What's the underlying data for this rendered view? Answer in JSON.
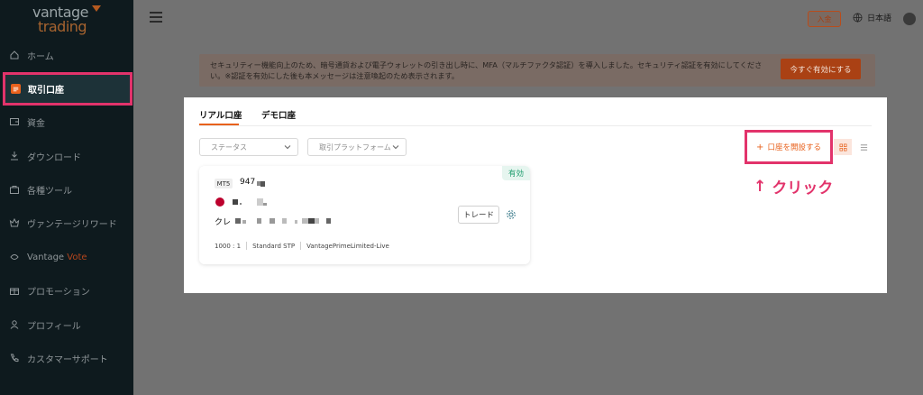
{
  "brand": {
    "line1": "vantage",
    "line2": "trading"
  },
  "sidebar": {
    "items": [
      {
        "label": "ホーム",
        "icon": "home-icon"
      },
      {
        "label": "取引口座",
        "icon": "account-icon",
        "active": true
      },
      {
        "label": "資金",
        "icon": "wallet-icon"
      },
      {
        "label": "ダウンロード",
        "icon": "download-icon"
      },
      {
        "label": "各種ツール",
        "icon": "tools-icon"
      },
      {
        "label": "ヴァンテージリワード",
        "icon": "reward-icon"
      },
      {
        "label": "Vantage",
        "label_accent": "Vote",
        "icon": "vote-icon"
      },
      {
        "label": "プロモーション",
        "icon": "gift-icon"
      },
      {
        "label": "プロフィール",
        "icon": "profile-icon"
      },
      {
        "label": "カスタマーサポート",
        "icon": "phone-icon"
      }
    ]
  },
  "header": {
    "deposit_label": "入金",
    "language": "日本語"
  },
  "notice": {
    "text": "セキュリティー機能向上のため、暗号通貨および電子ウォレットの引き出し時に、MFA（マルチファクタ認証）を導入しました。セキュリティ認証を有効にしてください。※認証を有効にした後も本メッセージは注意喚起のため表示されます。",
    "button_label": "今すぐ有効にする"
  },
  "tabs": [
    {
      "label": "リアル口座",
      "active": true
    },
    {
      "label": "デモ口座",
      "active": false
    }
  ],
  "filters": {
    "status_placeholder": "ステータス",
    "platform_placeholder": "取引プラットフォーム"
  },
  "open_account_label": "口座を開設する",
  "annotation": {
    "arrow": "↑",
    "text": "クリック"
  },
  "account": {
    "status": "有効",
    "platform": "MT5",
    "number_prefix": "947",
    "credit_prefix": "クレ",
    "trade_label": "トレード",
    "leverage": "1000 : 1",
    "type": "Standard STP",
    "server": "VantagePrimeLimited-Live"
  },
  "colors": {
    "accent": "#e8611c",
    "highlight": "#e2336b",
    "sidebar_bg": "#0e1a1e",
    "status_green": "#1e9d6e"
  }
}
